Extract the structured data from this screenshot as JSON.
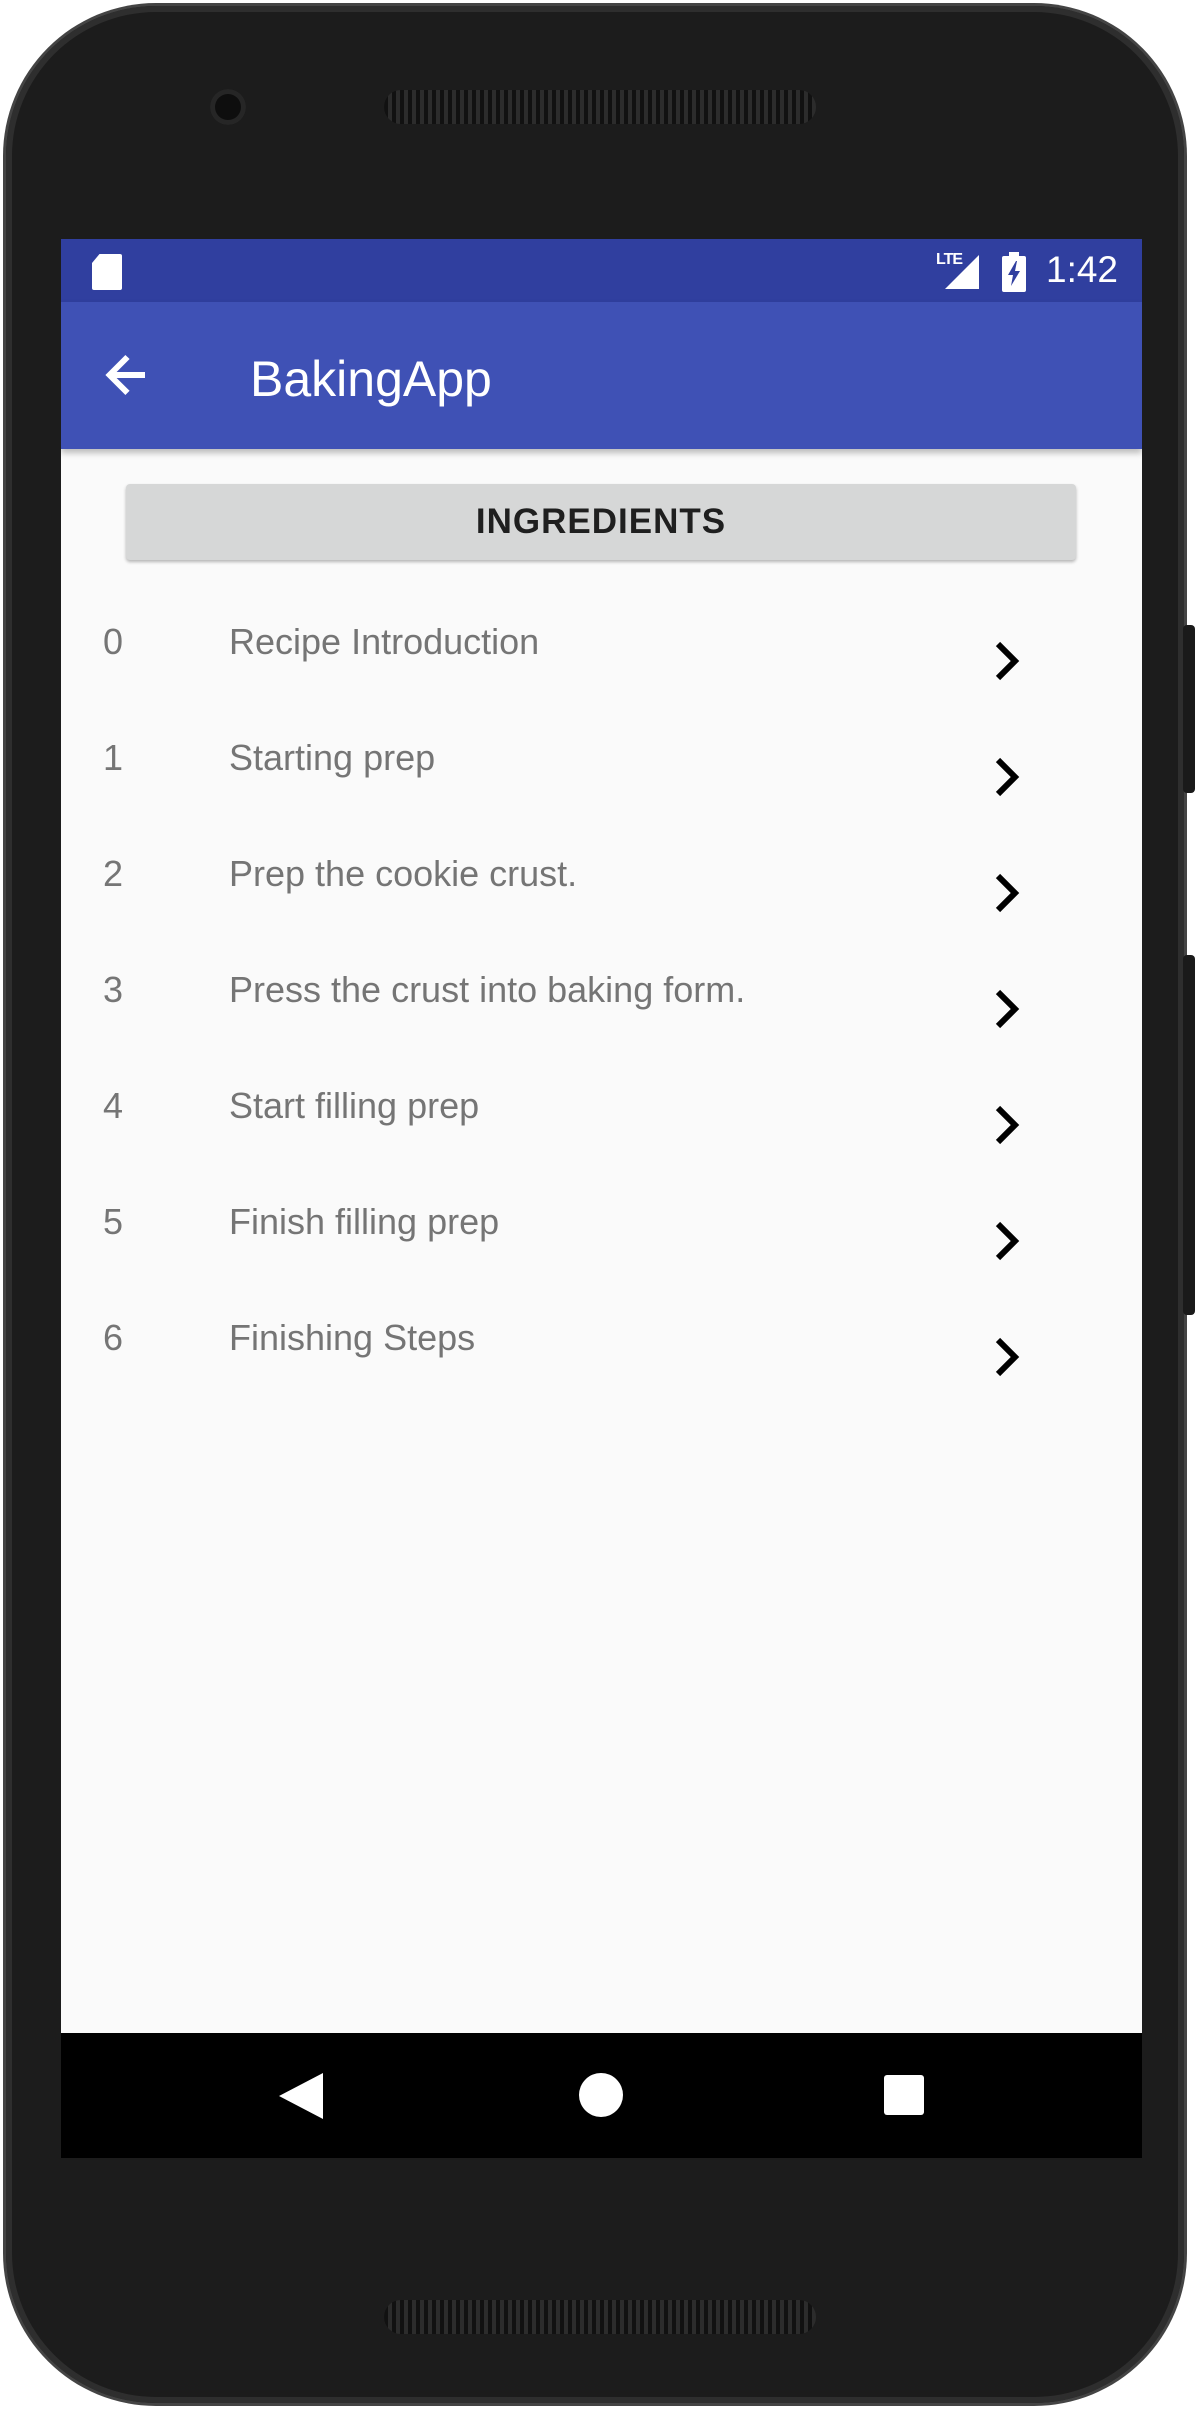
{
  "status_bar": {
    "network": "LTE",
    "time": "1:42"
  },
  "app_bar": {
    "title": "BakingApp",
    "back_icon": "arrow-back-icon"
  },
  "ingredients_button": {
    "label": "INGREDIENTS"
  },
  "steps": [
    {
      "number": "0",
      "description": "Recipe Introduction"
    },
    {
      "number": "1",
      "description": "Starting prep"
    },
    {
      "number": "2",
      "description": "Prep the cookie crust."
    },
    {
      "number": "3",
      "description": "Press the crust into baking form."
    },
    {
      "number": "4",
      "description": "Start filling prep"
    },
    {
      "number": "5",
      "description": "Finish filling prep"
    },
    {
      "number": "6",
      "description": "Finishing Steps"
    }
  ],
  "colors": {
    "status_bar": "#303f9f",
    "primary": "#3f51b5",
    "background": "#fafafa",
    "button": "#d6d7d7",
    "step_text": "#757575"
  }
}
